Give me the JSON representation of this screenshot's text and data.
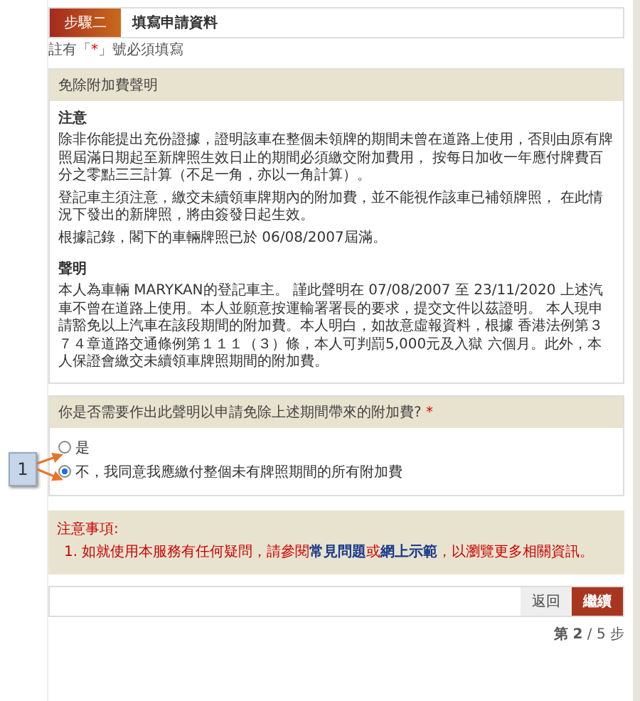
{
  "step": {
    "label": "步驟二",
    "title": "填寫申請資料"
  },
  "required_note": {
    "prefix": "註有「",
    "mark": "*",
    "suffix": "」號必須填寫"
  },
  "exemption_panel": {
    "title": "免除附加費聲明",
    "sections": [
      {
        "heading": "注意",
        "paragraphs": [
          "除非你能提出充份證據，證明該車在整個未領牌的期間未曾在道路上使用，否則由原有牌照屆滿日期起至新牌照生效日止的期間必須繳交附加費用， 按每日加收一年應付牌費百分之零點三三計算（不足一角，亦以一角計算）。",
          "登記車主須注意，繳交未續領車牌期內的附加費，並不能視作該車已補領牌照， 在此情況下發出的新牌照，將由簽發日起生效。",
          "根據記錄，閣下的車輛牌照已於 06/08/2007屆滿。"
        ]
      },
      {
        "heading": "聲明",
        "paragraphs": [
          "本人為車輛 MARYKAN的登記車主。 謹此聲明在 07/08/2007 至 23/11/2020 上述汽車不曾在道路上使用。本人並願意按運輸署署長的要求，提交文件以茲證明。 本人現申請豁免以上汽車在該段期間的附加費。本人明白，如故意虛報資料，根據 香港法例第３７４章道路交通條例第１１１（３）條，本人可判罰5,000元及入獄 六個月。此外，本人保證會繳交未續領車牌照期間的附加費。"
        ]
      }
    ]
  },
  "question": {
    "text": "你是否需要作出此聲明以申請免除上述期間帶來的附加費?",
    "required": true,
    "options": [
      {
        "label": "是",
        "selected": false
      },
      {
        "label": "不，我同意我應繳付整個未有牌照期間的所有附加費",
        "selected": true
      }
    ]
  },
  "callout": {
    "label": "1"
  },
  "notes": {
    "title": "注意事項:",
    "items": [
      {
        "segments": [
          {
            "kind": "text",
            "text": "1. 如就使用本服務有任何疑問，請參閱"
          },
          {
            "kind": "link",
            "text": "常見問題"
          },
          {
            "kind": "text",
            "text": "或"
          },
          {
            "kind": "link",
            "text": "網上示範"
          },
          {
            "kind": "text",
            "text": "，以瀏覽更多相關資訊。"
          }
        ]
      }
    ]
  },
  "buttons": {
    "back": "返回",
    "next": "繼續"
  },
  "pager": "**第 2** / 5 步"
}
